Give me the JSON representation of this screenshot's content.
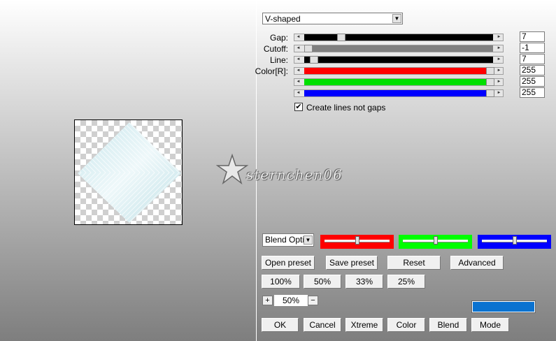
{
  "effect_dropdown": {
    "value": "V-shaped"
  },
  "sliders": [
    {
      "label": "Gap:",
      "value": "7",
      "level": 0.18,
      "color": "#000000"
    },
    {
      "label": "Cutoff:",
      "value": "-1",
      "level": 0.0,
      "color": "#808080"
    },
    {
      "label": "Line:",
      "value": "7",
      "level": 0.03,
      "color": "#000000"
    },
    {
      "label": "Color[R]:",
      "value": "255",
      "level": 1.0,
      "color": "#ff0000"
    },
    {
      "label": "",
      "value": "255",
      "level": 1.0,
      "color": "#00e000"
    },
    {
      "label": "",
      "value": "255",
      "level": 1.0,
      "color": "#0000ff"
    }
  ],
  "checkbox": {
    "label": "Create lines not gaps",
    "checked": true
  },
  "blend_dropdown": {
    "value": "Blend Optio"
  },
  "color_sliders": [
    {
      "name": "red",
      "color": "#ff0000",
      "level": 0.5
    },
    {
      "name": "green",
      "color": "#00ff00",
      "level": 0.5
    },
    {
      "name": "blue",
      "color": "#0000ff",
      "level": 0.5
    }
  ],
  "preset_buttons": {
    "open": "Open preset",
    "save": "Save preset",
    "reset": "Reset",
    "advanced": "Advanced"
  },
  "zoom_presets": [
    "100%",
    "50%",
    "33%",
    "25%"
  ],
  "zoom": {
    "plus": "+",
    "value": "50%",
    "minus": "−"
  },
  "color_swatch": "#0a72d0",
  "bottom_buttons": {
    "ok": "OK",
    "cancel": "Cancel",
    "xtreme": "Xtreme",
    "color": "Color",
    "blend": "Blend",
    "mode": "Mode"
  },
  "watermark": {
    "text": "sternchen06"
  }
}
